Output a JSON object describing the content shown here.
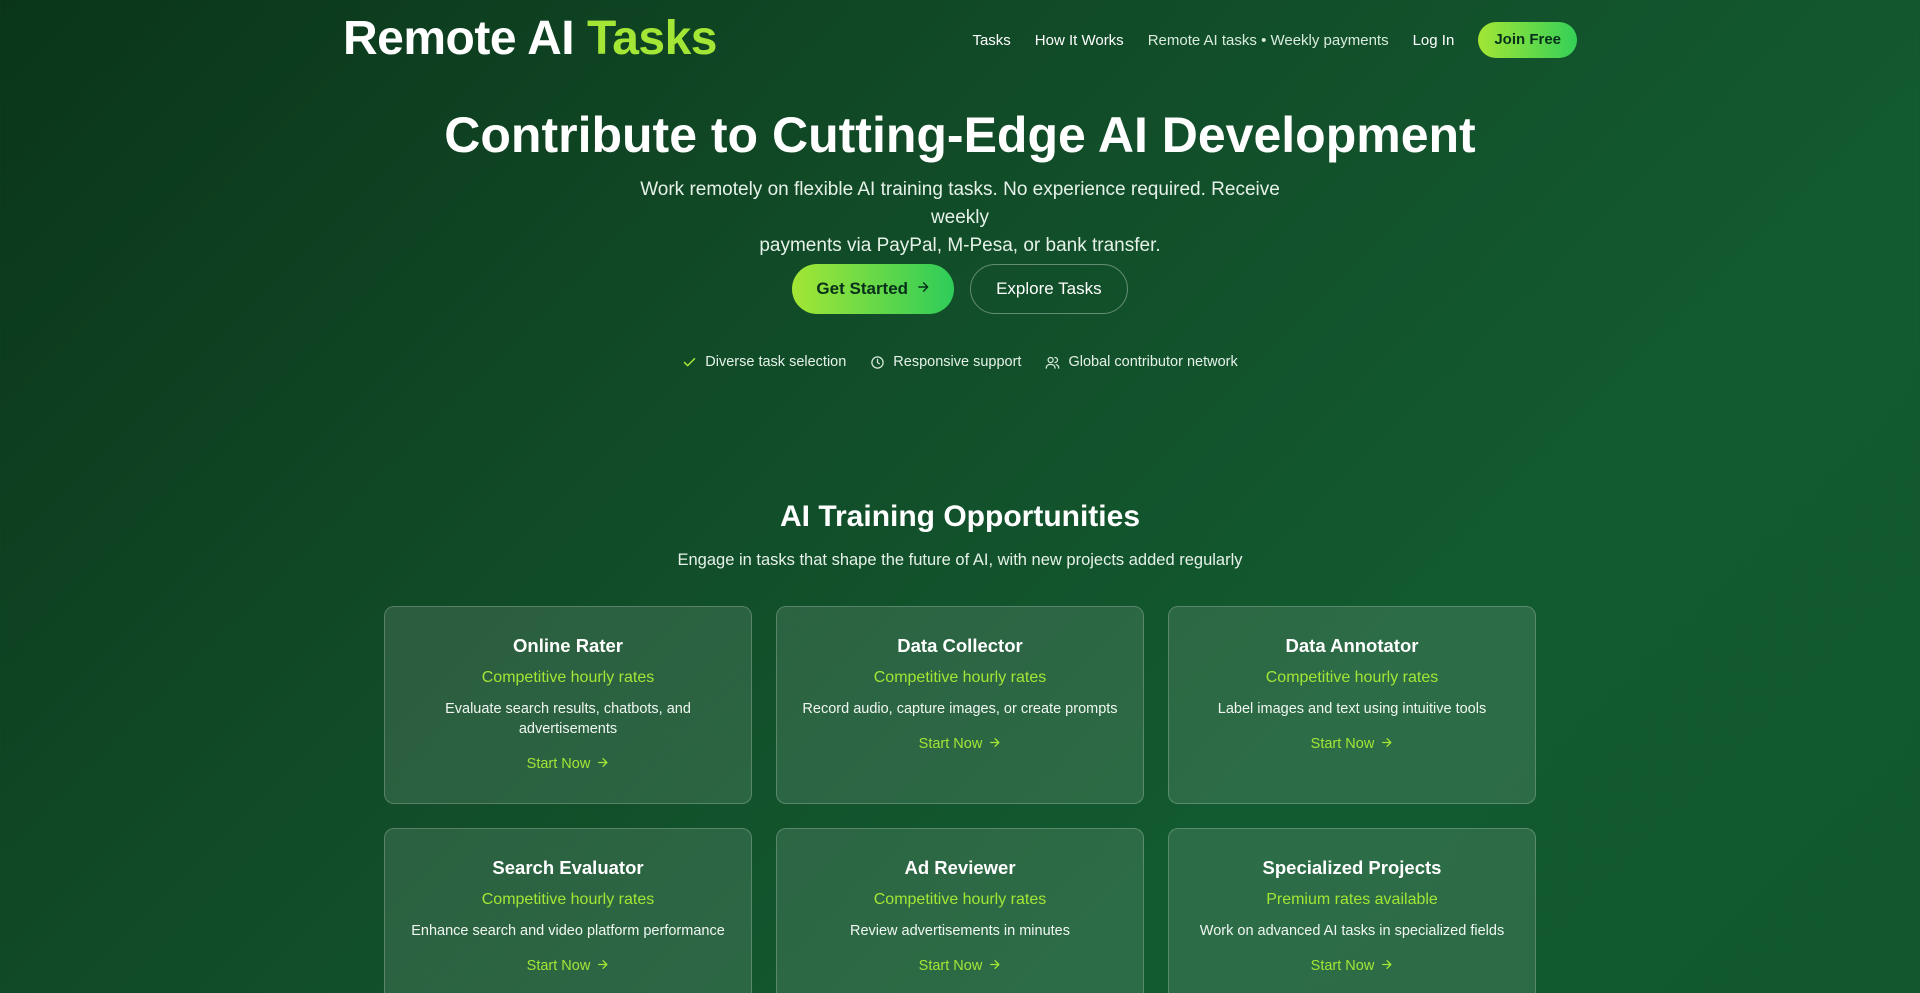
{
  "header": {
    "logo_main": "Remote AI",
    "logo_accent": "Tasks",
    "nav": [
      {
        "label": "Tasks"
      },
      {
        "label": "How It Works"
      },
      {
        "label": "Remote AI tasks • Weekly payments"
      },
      {
        "label": "Log In"
      }
    ],
    "join_label": "Join Free"
  },
  "hero": {
    "title": "Contribute to Cutting-Edge AI Development",
    "subtitle_line1": "Work remotely on flexible AI training tasks. No experience required. Receive weekly",
    "subtitle_line2": "payments via PayPal, M-Pesa, or bank transfer.",
    "primary_cta": "Get Started",
    "secondary_cta": "Explore Tasks",
    "features": [
      {
        "label": "Diverse task selection",
        "icon": "check-icon"
      },
      {
        "label": "Responsive support",
        "icon": "clock-icon"
      },
      {
        "label": "Global contributor network",
        "icon": "users-icon"
      }
    ]
  },
  "section": {
    "title": "AI Training Opportunities",
    "subtitle": "Engage in tasks that shape the future of AI, with new projects added regularly",
    "cards": [
      {
        "title": "Online Rater",
        "rate": "Competitive hourly rates",
        "desc": "Evaluate search results, chatbots, and advertisements",
        "link": "Start Now"
      },
      {
        "title": "Data Collector",
        "rate": "Competitive hourly rates",
        "desc": "Record audio, capture images, or create prompts",
        "link": "Start Now"
      },
      {
        "title": "Data Annotator",
        "rate": "Competitive hourly rates",
        "desc": "Label images and text using intuitive tools",
        "link": "Start Now"
      },
      {
        "title": "Search Evaluator",
        "rate": "Competitive hourly rates",
        "desc": "Enhance search and video platform performance",
        "link": "Start Now"
      },
      {
        "title": "Ad Reviewer",
        "rate": "Competitive hourly rates",
        "desc": "Review advertisements in minutes",
        "link": "Start Now"
      },
      {
        "title": "Specialized Projects",
        "rate": "Premium rates available",
        "desc": "Work on advanced AI tasks in specialized fields",
        "link": "Start Now"
      }
    ]
  },
  "colors": {
    "accent": "#a3e635",
    "background": "#114a27"
  }
}
